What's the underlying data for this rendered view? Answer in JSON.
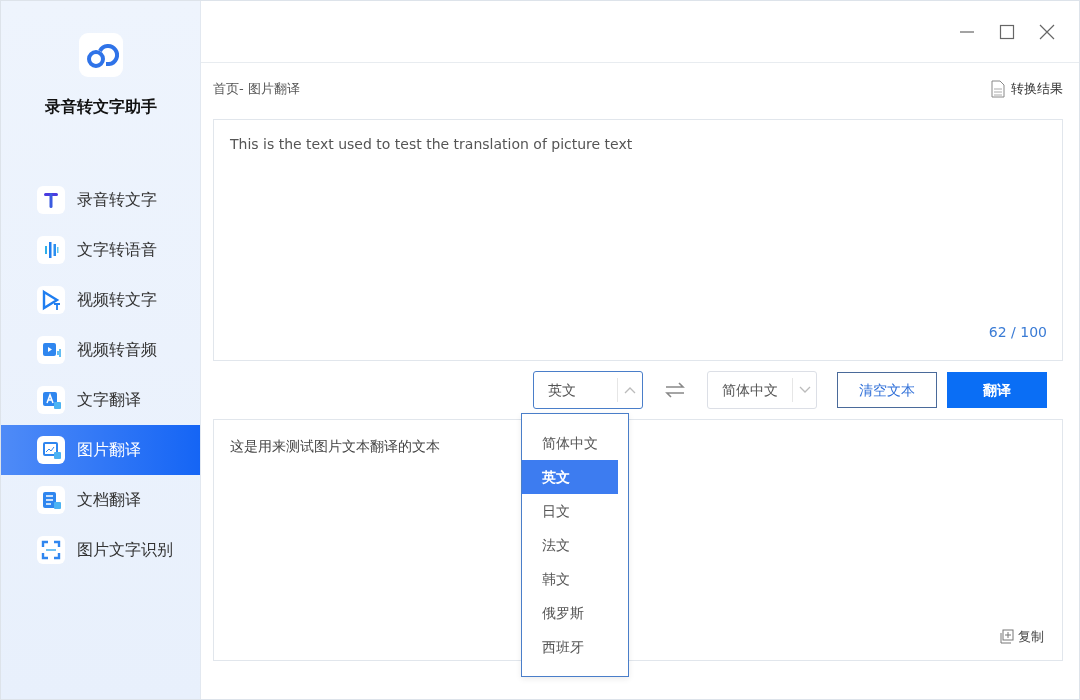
{
  "app": {
    "title": "录音转文字助手"
  },
  "sidebar": {
    "items": [
      {
        "label": "录音转文字",
        "selected": false
      },
      {
        "label": "文字转语音",
        "selected": false
      },
      {
        "label": "视频转文字",
        "selected": false
      },
      {
        "label": "视频转音频",
        "selected": false
      },
      {
        "label": "文字翻译",
        "selected": false
      },
      {
        "label": "图片翻译",
        "selected": true
      },
      {
        "label": "文档翻译",
        "selected": false
      },
      {
        "label": "图片文字识别",
        "selected": false
      }
    ]
  },
  "breadcrumb": "首页- 图片翻译",
  "result_link": "转换结果",
  "source": {
    "value": "This is the text used to test the translation of picture text",
    "count": "62 / 100"
  },
  "from_language": {
    "value": "英文",
    "expanded": true,
    "options": [
      {
        "label": "简体中文",
        "selected": false
      },
      {
        "label": "英文",
        "selected": true
      },
      {
        "label": "日文",
        "selected": false
      },
      {
        "label": "法文",
        "selected": false
      },
      {
        "label": "韩文",
        "selected": false
      },
      {
        "label": "俄罗斯",
        "selected": false
      },
      {
        "label": "西班牙",
        "selected": false
      }
    ]
  },
  "to_language": {
    "value": "简体中文",
    "expanded": false
  },
  "buttons": {
    "clear": "清空文本",
    "translate": "翻译"
  },
  "output": {
    "value": "这是用来测试图片文本翻译的文本",
    "copy": "复制"
  }
}
